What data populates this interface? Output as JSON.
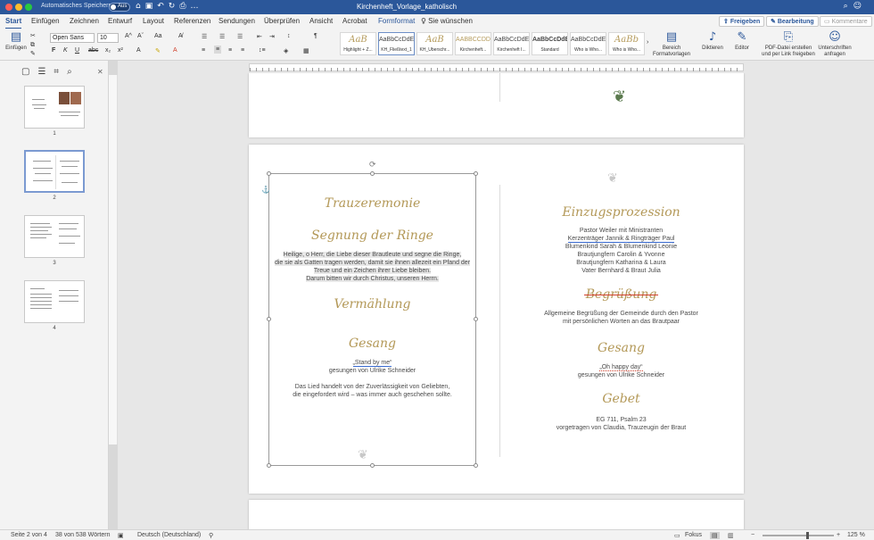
{
  "window": {
    "autosave_label": "Automatisches Speichern",
    "autosave_state": "Aus",
    "doc_title": "Kirchenheft_Vorlage_katholisch",
    "accent": "#2b579a"
  },
  "tabs": [
    "Start",
    "Einfügen",
    "Zeichnen",
    "Entwurf",
    "Layout",
    "Referenzen",
    "Sendungen",
    "Überprüfen",
    "Ansicht",
    "Acrobat",
    "Formformat",
    "Sie wünschen"
  ],
  "tab_active": "Start",
  "share": {
    "freigeben": "Freigeben",
    "bearbeitung": "Bearbeitung",
    "kommentare": "Kommentare"
  },
  "ribbon": {
    "paste_label": "Einfügen",
    "font_name": "Open Sans",
    "font_size": "10",
    "styles": [
      {
        "preview": "AaB",
        "label": "Highlight + Z..."
      },
      {
        "preview": "AaBbCcDdEe",
        "label": "KH_Fließtext_1"
      },
      {
        "preview": "AaB",
        "label": "KH_Überschr..."
      },
      {
        "preview": "AABBCCDD",
        "label": "Kirchenheft..."
      },
      {
        "preview": "AaBbCcDdE",
        "label": "Kirchenheft I..."
      },
      {
        "preview": "AaBbCcDdEe",
        "label": "Standard"
      },
      {
        "preview": "AaBbCcDdEe",
        "label": "Who is Who..."
      },
      {
        "preview": "AaBb",
        "label": "Who is Who..."
      }
    ],
    "style_pane": "Bereich Formatvorlagen",
    "dictate": "Diktieren",
    "editor": "Editor",
    "pdf": "PDF-Datei erstellen und per Link freigeben",
    "signatures": "Unterschriften anfragen"
  },
  "thumbnails": [
    "1",
    "2",
    "3",
    "4"
  ],
  "doc": {
    "left": {
      "h_trauzeremonie": "Trauzeremonie",
      "h_segnung": "Segnung der Ringe",
      "blessing": [
        "Heilige, o Herr, die Liebe dieser Brautleute und segne die Ringe,",
        "die sie als Gatten tragen werden, damit sie ihnen allezeit ein Pfand der",
        "Treue und ein Zeichen ihrer Liebe bleiben.",
        "Darum bitten wir durch Christus, unseren Herrn."
      ],
      "h_vermaehlung": "Vermählung",
      "h_gesang": "Gesang",
      "song_title": "„Stand by me“",
      "song_by": "gesungen von Ulrike Schneider",
      "song_desc": [
        "Das Lied handelt von der Zuverlässigkeit von Geliebten,",
        "die eingefordert wird – was immer auch geschehen sollte."
      ]
    },
    "right": {
      "h_einzug": "Einzugsprozession",
      "einzug": [
        "Pastor Weiler mit Ministranten",
        "Kerzenträger Jannik & Ringträger Paul",
        "Blumenkind Sarah & Blumenkind Leonie",
        "Brautjungfern Carolin & Yvonne",
        "Brautjungfern Katharina & Laura",
        "Vater Bernhard & Braut Julia"
      ],
      "h_begruessung": "Begrüßung",
      "begruessung": [
        "Allgemeine Begrüßung der Gemeinde durch den Pastor",
        "mit persönlichen Worten an das Brautpaar"
      ],
      "h_gesang": "Gesang",
      "song_title": "„Oh happy day“",
      "song_by": "gesungen von Ulrike Schneider",
      "h_gebet": "Gebet",
      "gebet": [
        "EG 711, Psalm 23",
        "vorgetragen von Claudia, Trauzeugin der Braut"
      ]
    }
  },
  "status": {
    "page": "Seite 2 von 4",
    "words": "38 von 538 Wörtern",
    "language": "Deutsch (Deutschland)",
    "focus": "Fokus",
    "zoom": "125 %"
  }
}
